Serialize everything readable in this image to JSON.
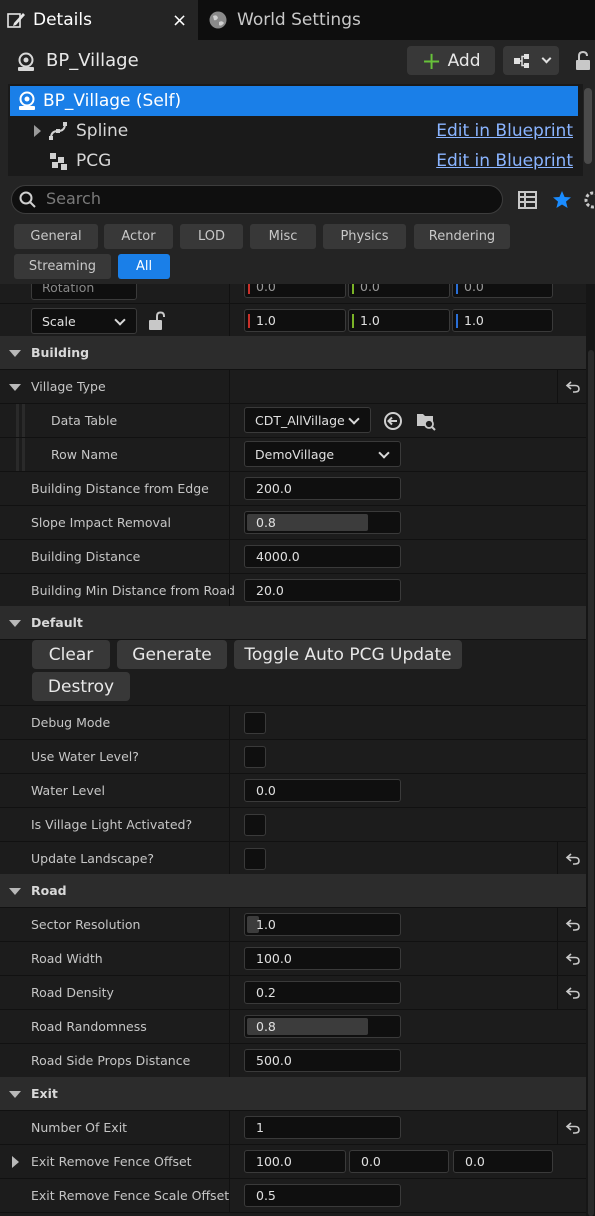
{
  "tabs": [
    {
      "label": "Details",
      "icon": "pencil-icon",
      "active": true
    },
    {
      "label": "World Settings",
      "icon": "globe-icon",
      "active": false
    }
  ],
  "tab_close": "×",
  "header": {
    "object_name": "BP_Village",
    "add_label": "Add"
  },
  "tree": [
    {
      "label": "BP_Village (Self)",
      "icon": "actor-icon",
      "selected": true
    },
    {
      "label": "Spline",
      "icon": "spline-icon",
      "link": "Edit in Blueprint"
    },
    {
      "label": "PCG",
      "icon": "pcg-icon",
      "link": "Edit in Blueprint"
    }
  ],
  "search": {
    "placeholder": "Search"
  },
  "filters": [
    "General",
    "Actor",
    "LOD",
    "Misc",
    "Physics",
    "Rendering",
    "Streaming",
    "All"
  ],
  "active_filter": "All",
  "transform": {
    "rotation_label": "Rotation",
    "rotation_values": [
      "0.0",
      "0.0",
      "0.0"
    ],
    "scale_label": "Scale",
    "scale_values": [
      "1.0",
      "1.0",
      "1.0"
    ]
  },
  "building": {
    "title": "Building",
    "village_type_label": "Village Type",
    "data_table_label": "Data Table",
    "data_table_value": "CDT_AllVillage",
    "row_name_label": "Row Name",
    "row_name_value": "DemoVillage",
    "edge_label": "Building Distance from Edge",
    "edge_value": "200.0",
    "slope_label": "Slope Impact Removal",
    "slope_value": "0.8",
    "slope_fraction": 0.8,
    "distance_label": "Building Distance",
    "distance_value": "4000.0",
    "road_min_label": "Building Min Distance from Road",
    "road_min_value": "20.0"
  },
  "default": {
    "title": "Default",
    "buttons": [
      "Clear",
      "Generate",
      "Toggle Auto PCG Update",
      "Destroy"
    ],
    "debug_label": "Debug Mode",
    "water_q_label": "Use Water Level?",
    "water_label": "Water Level",
    "water_value": "0.0",
    "light_label": "Is Village Light Activated?",
    "landscape_label": "Update Landscape?"
  },
  "road": {
    "title": "Road",
    "sector_label": "Sector Resolution",
    "sector_value": "1.0",
    "sector_fraction": 0.08,
    "width_label": "Road Width",
    "width_value": "100.0",
    "density_label": "Road Density",
    "density_value": "0.2",
    "random_label": "Road Randomness",
    "random_value": "0.8",
    "random_fraction": 0.8,
    "props_label": "Road Side Props Distance",
    "props_value": "500.0"
  },
  "exit": {
    "title": "Exit",
    "count_label": "Number Of Exit",
    "count_value": "1",
    "fence_label": "Exit Remove Fence Offset",
    "fence_values": [
      "100.0",
      "0.0",
      "0.0"
    ],
    "scale_label": "Exit Remove Fence Scale Offset",
    "scale_value": "0.5"
  },
  "colors": {
    "accent": "#1a7fe8",
    "x_axis": "#c8302a",
    "y_axis": "#7ab327",
    "z_axis": "#2a6fd6",
    "add_plus": "#67c23a"
  }
}
